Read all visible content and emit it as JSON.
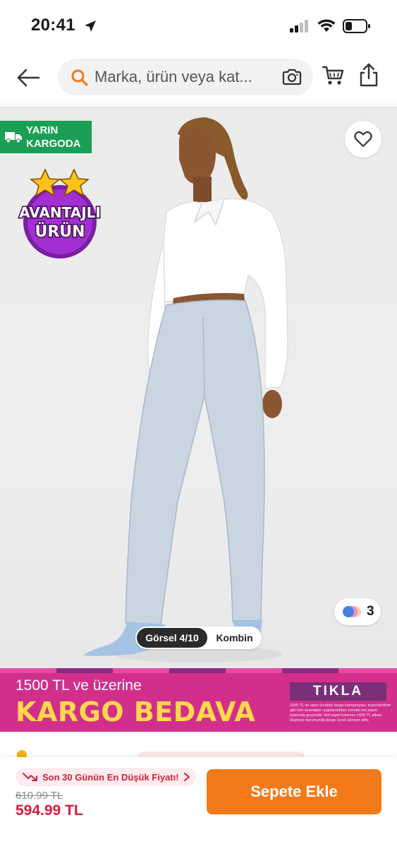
{
  "status_bar": {
    "time": "20:41"
  },
  "header": {
    "search_placeholder": "Marka, ürün veya kat..."
  },
  "product": {
    "shipping_badge": {
      "line1": "YARIN",
      "line2": "KARGODA"
    },
    "advantage_badge": {
      "line1": "AVANTAJLI",
      "line2": "ÜRÜN"
    },
    "color_count": "3",
    "image_toggle": {
      "active": "Görsel 4/10",
      "inactive": "Kombin"
    }
  },
  "promo": {
    "line1": "1500 TL ve üzerine",
    "line2": "KARGO BEDAVA",
    "cta": "TIKLA",
    "note": "1500 TL ve üzeri ücretsiz kargo kampanyası, kupon/indirim gibi tüm avantajlar uygulandıktan sonraki net sepet tutarında geçerlidir. Net sepet tutarının 1500 TL altına düşmesi durumunda kargo ücreti alınıyor sittir."
  },
  "bottom_bar": {
    "lowest_price_label": "Son 30 Günün En Düşük Fiyatı!",
    "old_price": "610.99 TL",
    "new_price": "594.99 TL",
    "add_to_cart": "Sepete Ekle"
  },
  "colors": {
    "brand_orange": "#f27a1a",
    "price_red": "#d21f3c",
    "shipping_green": "#1a9f55",
    "promo_pink": "#d22f8d",
    "promo_yellow": "#ffd94a"
  }
}
